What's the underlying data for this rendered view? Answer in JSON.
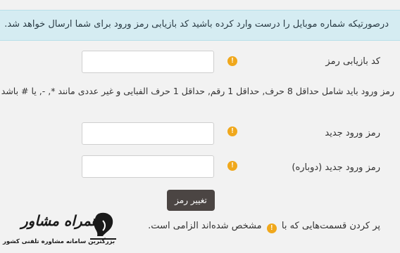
{
  "alert": {
    "message": "درصورتیکه شماره موبایل را درست وارد کرده باشید کد بازیابی رمز ورود برای شما ارسال خواهد شد."
  },
  "form": {
    "recovery_code": {
      "label": "کد بازیابی رمز",
      "value": ""
    },
    "password_help": "رمز ورود باید شامل حداقل 8 حرف, حداقل 1 رقم, حداقل 1 حرف الفبایی و غیر عددی مانند *, -, یا # باشد",
    "new_password": {
      "label": "رمز ورود جدید",
      "value": ""
    },
    "new_password_confirm": {
      "label": "رمز ورود جدید (دوباره)",
      "value": ""
    },
    "submit_label": "تغییر رمز",
    "required_icon": "!",
    "required_note_before": "پر کردن قسمت‌هایی که با",
    "required_note_after": "مشخص شده‌اند الزامی است."
  },
  "watermark": {
    "brand": "همراه مشاور",
    "tagline": "بزرگترین سامانه مشاوره تلفنی کشور",
    "color": "#1a1a1a"
  },
  "colors": {
    "required": "#f0a81c",
    "alert_bg": "#d5ecf2",
    "button_bg": "#4b4543"
  }
}
